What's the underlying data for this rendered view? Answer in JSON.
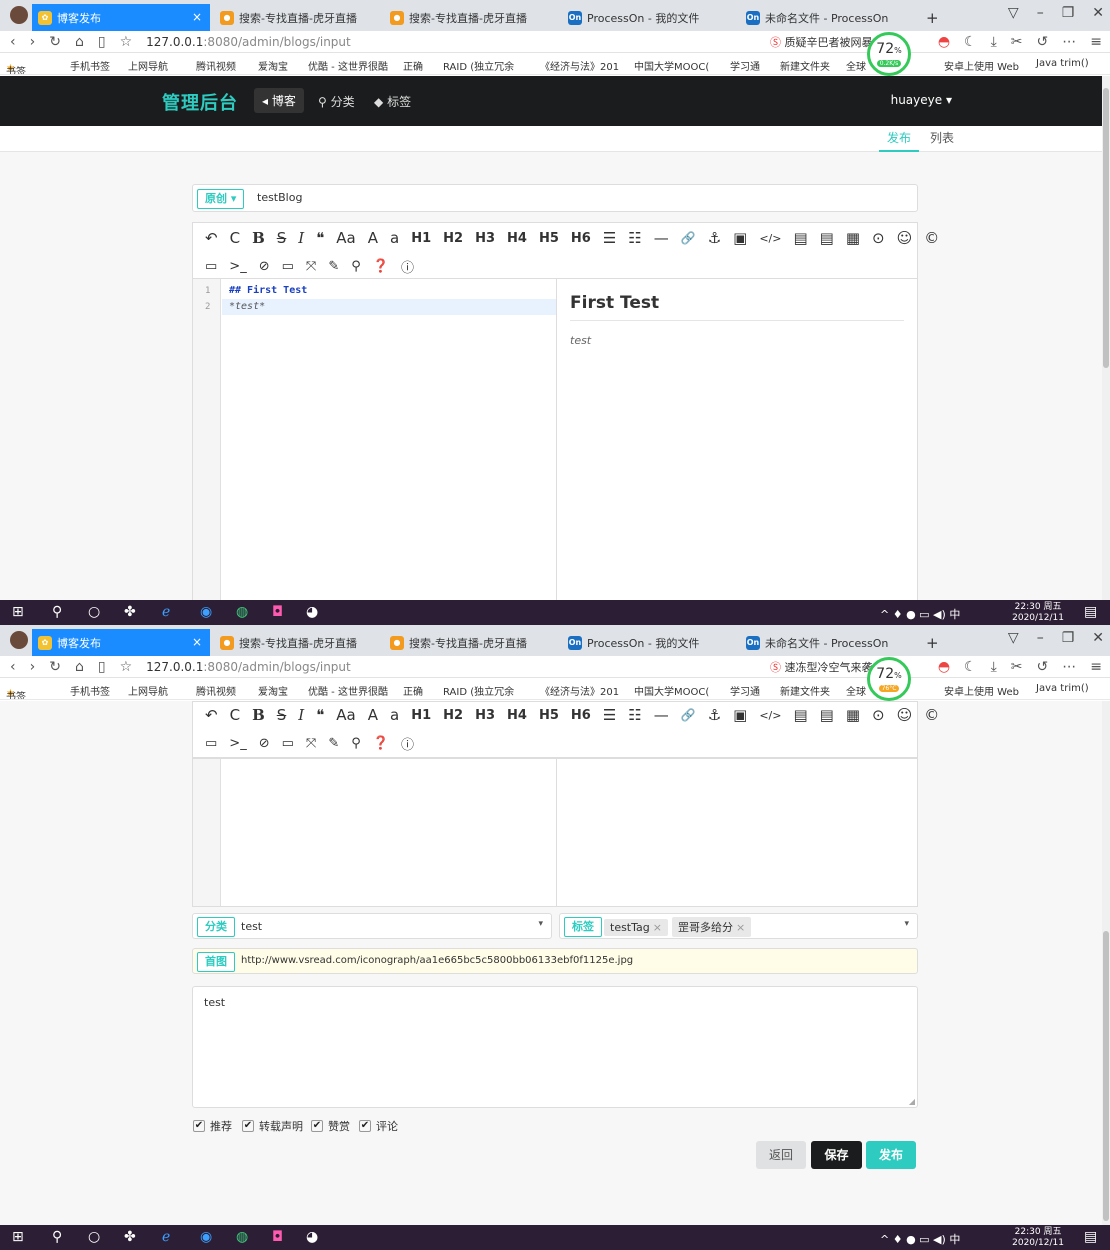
{
  "browser": {
    "tabs": [
      {
        "title": "博客发布"
      },
      {
        "title": "搜索-专找直播-虎牙直播"
      },
      {
        "title": "搜索-专找直播-虎牙直播"
      },
      {
        "title": "ProcessOn - 我的文件"
      },
      {
        "title": "未命名文件 - ProcessOn"
      }
    ],
    "new_tab": "+",
    "url_host": "127.0.0.1",
    "url_path": ":8080/admin/blogs/input",
    "search_top": "质疑辛巴者被网暴",
    "search_bottom": "速冻型冷空气来袭",
    "bookmarks": [
      "书签",
      "手机书签",
      "上网导航",
      "腾讯视频",
      "爱淘宝",
      "优酷 - 这世界很酷",
      "正确",
      "RAID (独立冗余",
      "《经济与法》201",
      "中国大学MOOC(",
      "学习通",
      "新建文件夹",
      "全球",
      "安卓上使用 Web",
      "Java trim()"
    ],
    "badge_value": "72",
    "badge_unit": "%",
    "badge_speed": "0.2K/s",
    "badge_temp": "76°C"
  },
  "admin": {
    "brand": "管理后台",
    "menu": [
      "博客",
      "分类",
      "标签"
    ],
    "user": "huayeye",
    "subnav": [
      "发布",
      "列表"
    ]
  },
  "form": {
    "type_label": "原创",
    "title_value": "testBlog",
    "toolbar_row1": [
      "↶",
      "C",
      "B",
      "S",
      "I",
      "❝",
      "Aa",
      "A",
      "a",
      "H1",
      "H2",
      "H3",
      "H4",
      "H5",
      "H6",
      "☰",
      "☷",
      "—",
      "🔗",
      "⚓",
      "▣",
      "</>",
      "▤",
      "▤",
      "▦",
      "⊙",
      "☺",
      "©"
    ],
    "toolbar_row2": [
      "▭",
      ">_",
      "⊘",
      "▭",
      "⤧",
      "✎",
      "⚲",
      "❓",
      "ⓘ"
    ],
    "code_lines": [
      "## First Test",
      "*test*"
    ],
    "line_numbers": [
      "1",
      "2"
    ],
    "preview_heading": "First Test",
    "preview_text": "test",
    "category_label": "分类",
    "category_value": "test",
    "tag_label": "标签",
    "tags": [
      "testTag",
      "罡哥多给分"
    ],
    "cover_label": "首图",
    "cover_value": "http://www.vsread.com/iconograph/aa1e665bc5c5800bb06133ebf0f1125e.jpg",
    "description_value": "test",
    "checkboxes": [
      "推荐",
      "转载声明",
      "赞赏",
      "评论"
    ],
    "btn_back": "返回",
    "btn_save": "保存",
    "btn_publish": "发布"
  },
  "taskbar": {
    "time": "22:30 周五",
    "date": "2020/12/11",
    "ime": "中"
  },
  "colors": {
    "accent": "#2ecbc0",
    "nav_bg": "#1b1c1d",
    "tab_active": "#1a8cff",
    "taskbar": "#2c1f35"
  }
}
